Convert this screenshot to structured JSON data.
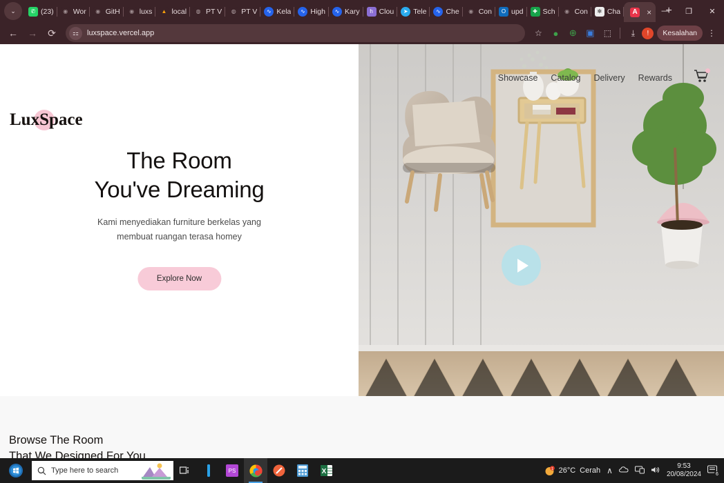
{
  "browser": {
    "tab_list_icon": "chevron-down-icon",
    "tabs": [
      {
        "label": "(23)",
        "icon": "whatsapp-icon",
        "color": "#25d366",
        "glyph": "●"
      },
      {
        "label": "Wor",
        "icon": "github-icon",
        "color": "#3b2328",
        "glyph": "●"
      },
      {
        "label": "GitH",
        "icon": "github-icon",
        "color": "#3b2328",
        "glyph": "●"
      },
      {
        "label": "luxs",
        "icon": "github-icon",
        "color": "#3b2328",
        "glyph": "●"
      },
      {
        "label": "local",
        "icon": "laravel-icon",
        "color": "#3b2328",
        "glyph": "▲"
      },
      {
        "label": "PT V",
        "icon": "globe-icon",
        "color": "#3b2328",
        "glyph": "●"
      },
      {
        "label": "PT V",
        "icon": "globe-icon",
        "color": "#3b2328",
        "glyph": "●"
      },
      {
        "label": "Kela",
        "icon": "nextjs-blue-icon",
        "color": "#2563eb",
        "glyph": "∿"
      },
      {
        "label": "High",
        "icon": "nextjs-blue-icon",
        "color": "#2563eb",
        "glyph": "∿"
      },
      {
        "label": "Kary",
        "icon": "nextjs-blue-icon",
        "color": "#2563eb",
        "glyph": "∿"
      },
      {
        "label": "Clou",
        "icon": "h-purple-icon",
        "color": "#8b6fd4",
        "glyph": "h"
      },
      {
        "label": "Tele",
        "icon": "telegram-icon",
        "color": "#2aabee",
        "glyph": "➤"
      },
      {
        "label": "Che",
        "icon": "nextjs-blue-icon",
        "color": "#2563eb",
        "glyph": "∿"
      },
      {
        "label": "Con",
        "icon": "github-icon",
        "color": "#3b2328",
        "glyph": "●"
      },
      {
        "label": "upd",
        "icon": "outlook-icon",
        "color": "#0f6cbd",
        "glyph": "O"
      },
      {
        "label": "Sch",
        "icon": "sheets-icon",
        "color": "#16a34a",
        "glyph": "+"
      },
      {
        "label": "Con",
        "icon": "github-icon",
        "color": "#3b2328",
        "glyph": "●"
      },
      {
        "label": "Cha",
        "icon": "chatgpt-icon",
        "color": "#ededed",
        "glyph": "✻"
      }
    ],
    "active_tab": {
      "label": "",
      "favicon_letter": "A",
      "favicon_color": "#e8344a",
      "close_label": "×"
    },
    "new_tab_label": "+",
    "window_controls": {
      "minimize": "—",
      "maximize": "❐",
      "close": "✕"
    },
    "toolbar": {
      "back": "←",
      "forward": "→",
      "reload": "⟳",
      "site_info_icon": "tune-icon",
      "url": "luxspace.vercel.app",
      "bookmark_star": "☆",
      "ext_green": "●",
      "ext_add": "⊕",
      "ext_blue": "▣",
      "ext_puzzle": "⬚",
      "download": "⤓",
      "error_badge": "!",
      "profile_label": "Kesalahan",
      "menu": "⋮"
    }
  },
  "site": {
    "logo": {
      "part1": "Lux",
      "highlight": "S",
      "part2": "pace"
    },
    "nav": [
      "Showcase",
      "Catalog",
      "Delivery",
      "Rewards"
    ],
    "cart_icon": "shopping-cart-icon",
    "hero": {
      "title_line1": "The Room",
      "title_line2": "You've Dreaming",
      "subtitle_line1": "Kami menyediakan furniture berkelas yang",
      "subtitle_line2": "membuat ruangan terasa homey",
      "cta_label": "Explore Now",
      "play_icon": "play-button-icon"
    },
    "section_below": {
      "heading_line1": "Browse The Room",
      "heading_line2": "That We Designed For You"
    },
    "colors": {
      "accent_pink": "#f8cbd8",
      "play_blue": "#b9e1e9",
      "section_bg": "#f8f8f8"
    }
  },
  "taskbar": {
    "start_icon": "windows-start-icon",
    "search_placeholder": "Type here to search",
    "pinned": [
      {
        "name": "task-view-icon",
        "glyph": "⧉",
        "color": "#e8e8e8"
      },
      {
        "name": "vscode-icon",
        "glyph": "❘",
        "color": "#2aa2e8"
      },
      {
        "name": "phpstorm-icon",
        "glyph": "PS",
        "color": "#c24be0"
      },
      {
        "name": "chrome-icon",
        "glyph": "◉",
        "color": "#e84a3c"
      },
      {
        "name": "postman-icon",
        "glyph": "╱",
        "color": "#f06529"
      },
      {
        "name": "calculator-icon",
        "glyph": "▦",
        "color": "#4c9ad4"
      },
      {
        "name": "excel-icon",
        "glyph": "X",
        "color": "#1d6f42"
      }
    ],
    "tray": {
      "weather_temp": "26°C",
      "weather_desc": "Cerah",
      "chevron": "∧",
      "onedrive": "☁",
      "network": "🖥",
      "volume": "🔊",
      "time": "9:53",
      "date": "20/08/2024",
      "notification_count": "6"
    }
  }
}
